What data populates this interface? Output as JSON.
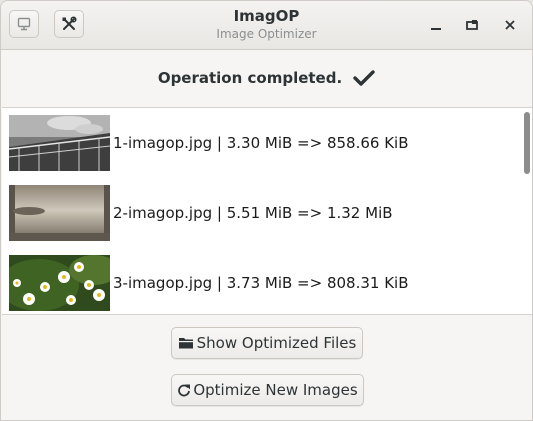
{
  "window": {
    "title": "ImagOP",
    "subtitle": "Image Optimizer"
  },
  "header_buttons": [
    {
      "icon": "save-icon"
    },
    {
      "icon": "tools-icon"
    }
  ],
  "window_controls": [
    {
      "icon": "minimize-icon"
    },
    {
      "icon": "maximize-icon"
    },
    {
      "icon": "close-icon"
    }
  ],
  "status": {
    "text": "Operation completed.",
    "icon": "checkmark-icon"
  },
  "files": [
    {
      "label": "1-imagop.jpg | 3.30 MiB => 858.66 KiB",
      "thumbnail": "bridge-railing-photo"
    },
    {
      "label": "2-imagop.jpg | 5.51 MiB => 1.32 MiB",
      "thumbnail": "misty-lake-photo"
    },
    {
      "label": "3-imagop.jpg | 3.73 MiB => 808.31 KiB",
      "thumbnail": "daisy-flowers-photo"
    }
  ],
  "actions": {
    "show_files_label": "Show Optimized Files",
    "show_files_icon": "folder-icon",
    "optimize_new_label": "Optimize New Images",
    "optimize_new_icon": "refresh-icon"
  }
}
